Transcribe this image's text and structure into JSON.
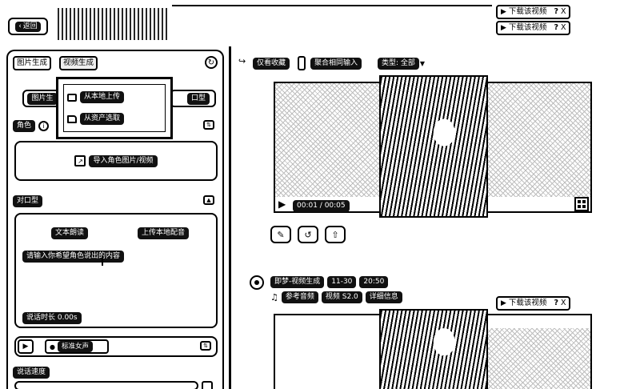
{
  "top": {
    "back_label": "返回"
  },
  "downloads": [
    {
      "label": "下载该视频",
      "help": "?",
      "close": "X"
    },
    {
      "label": "下载该视频",
      "help": "?",
      "close": "X"
    },
    {
      "label": "下载该视频",
      "help": "?",
      "close": "X"
    }
  ],
  "left": {
    "tabs": [
      "图片生成",
      "视频生成"
    ],
    "dropdown": {
      "local": "从本地上传",
      "assets": "从资产选取"
    },
    "partial_tab_a": "图片生",
    "partial_tab_b": "口型",
    "role": {
      "title": "角色",
      "import_label": "导入角色图片/视频"
    },
    "lipsync": {
      "title": "对口型",
      "tab_text": "文本朗读",
      "tab_upload": "上传本地配音",
      "placeholder": "请输入你希望角色说出的内容",
      "duration": "说话时长 0.00s",
      "voice": "标准女声"
    },
    "speed_title": "说话速度"
  },
  "right": {
    "filters": {
      "fav": "仅看收藏",
      "merge": "聚合相同输入",
      "type": "类型: 全部"
    },
    "video1": {
      "time": "00:01 / 00:05"
    },
    "task2": {
      "title": "即梦-视频生成",
      "date": "11-30",
      "time": "20:50",
      "ref": "参考音频",
      "version": "视频 S2.0",
      "detail": "详细信息"
    }
  }
}
